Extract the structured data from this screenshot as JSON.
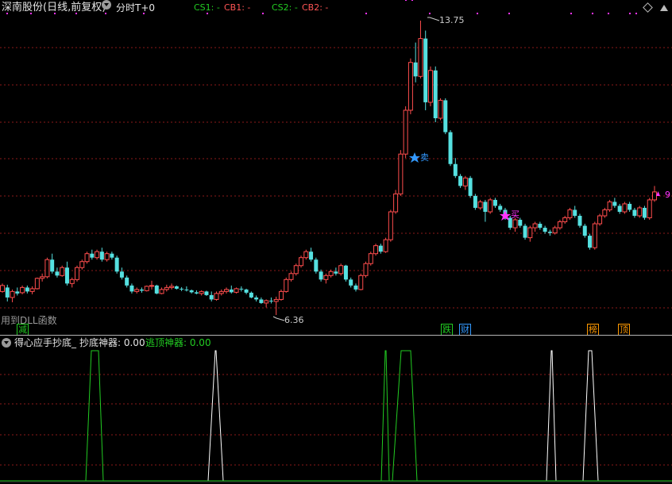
{
  "header": {
    "stock_title": "深南股份(日线,前复权)",
    "period_label": "分时T+0",
    "cs1_label": "CS1: -",
    "cb1_label": "CB1: -",
    "cs2_label": "CS2: -",
    "cb2_label": "CB2: -",
    "diamond_icon": "diamond-icon"
  },
  "main_chart": {
    "high_label": "13.75",
    "low_label": "6.36",
    "sell_marker": "卖",
    "buy_marker": "买",
    "right_edge_label": "9",
    "dll_notice": "用到DLL函数",
    "signal_labels": [
      {
        "text": "减",
        "color": "#22cc22"
      },
      {
        "text": "跌",
        "color": "#22cc22"
      },
      {
        "text": "财",
        "color": "#3399ff"
      },
      {
        "text": "榜",
        "color": "#ff9900"
      },
      {
        "text": "顶",
        "color": "#ff9900"
      }
    ],
    "colors": {
      "up": "#ff4d4d",
      "down": "#55e0e0",
      "grid": "#8b1a1a"
    },
    "candles": [
      [
        6.95,
        7.15,
        6.92,
        7.1
      ],
      [
        7.05,
        7.12,
        6.7,
        6.8
      ],
      [
        6.8,
        7.0,
        6.68,
        6.95
      ],
      [
        6.95,
        7.05,
        6.85,
        6.9
      ],
      [
        6.92,
        7.1,
        6.88,
        7.05
      ],
      [
        7.05,
        7.1,
        6.9,
        6.95
      ],
      [
        6.95,
        7.08,
        6.88,
        7.02
      ],
      [
        7.02,
        7.3,
        7.0,
        7.28
      ],
      [
        7.28,
        7.4,
        7.2,
        7.32
      ],
      [
        7.32,
        7.8,
        7.28,
        7.75
      ],
      [
        7.75,
        7.9,
        7.4,
        7.45
      ],
      [
        7.45,
        7.55,
        7.3,
        7.35
      ],
      [
        7.35,
        7.6,
        7.32,
        7.55
      ],
      [
        7.55,
        7.7,
        7.1,
        7.15
      ],
      [
        7.15,
        7.3,
        7.05,
        7.25
      ],
      [
        7.25,
        7.6,
        7.2,
        7.55
      ],
      [
        7.55,
        7.75,
        7.5,
        7.7
      ],
      [
        7.7,
        7.95,
        7.65,
        7.9
      ],
      [
        7.9,
        8.0,
        7.75,
        7.8
      ],
      [
        7.8,
        8.0,
        7.75,
        7.95
      ],
      [
        7.95,
        8.05,
        7.7,
        7.75
      ],
      [
        7.75,
        7.95,
        7.7,
        7.9
      ],
      [
        7.9,
        7.95,
        7.75,
        7.8
      ],
      [
        7.8,
        7.85,
        7.4,
        7.45
      ],
      [
        7.45,
        7.55,
        7.25,
        7.3
      ],
      [
        7.3,
        7.35,
        7.05,
        7.1
      ],
      [
        7.1,
        7.15,
        6.9,
        6.95
      ],
      [
        6.95,
        7.05,
        6.9,
        7.0
      ],
      [
        7.0,
        7.05,
        6.92,
        6.97
      ],
      [
        6.97,
        7.1,
        6.95,
        7.08
      ],
      [
        7.08,
        7.22,
        7.0,
        7.1
      ],
      [
        7.1,
        7.12,
        6.88,
        6.9
      ],
      [
        6.9,
        7.05,
        6.88,
        7.0
      ],
      [
        7.0,
        7.12,
        6.95,
        7.05
      ],
      [
        7.05,
        7.15,
        7.0,
        7.08
      ],
      [
        7.08,
        7.1,
        7.0,
        7.02
      ],
      [
        7.02,
        7.06,
        6.96,
        7.0
      ],
      [
        7.0,
        7.08,
        6.95,
        6.98
      ],
      [
        6.98,
        7.0,
        6.9,
        6.93
      ],
      [
        6.93,
        6.98,
        6.88,
        6.9
      ],
      [
        6.9,
        6.98,
        6.85,
        6.95
      ],
      [
        6.95,
        6.97,
        6.84,
        6.86
      ],
      [
        6.86,
        6.95,
        6.7,
        6.75
      ],
      [
        6.75,
        6.95,
        6.72,
        6.9
      ],
      [
        6.9,
        7.0,
        6.85,
        6.95
      ],
      [
        6.95,
        7.05,
        6.9,
        7.0
      ],
      [
        7.0,
        7.1,
        6.9,
        6.93
      ],
      [
        6.93,
        7.05,
        6.9,
        7.02
      ],
      [
        7.02,
        7.08,
        6.95,
        7.0
      ],
      [
        7.0,
        7.02,
        6.88,
        6.92
      ],
      [
        6.92,
        6.95,
        6.78,
        6.8
      ],
      [
        6.8,
        6.85,
        6.7,
        6.75
      ],
      [
        6.75,
        6.8,
        6.64,
        6.66
      ],
      [
        6.66,
        6.75,
        6.55,
        6.72
      ],
      [
        6.72,
        6.8,
        6.65,
        6.7
      ],
      [
        6.7,
        6.82,
        6.36,
        6.75
      ],
      [
        6.75,
        7.0,
        6.72,
        6.95
      ],
      [
        6.95,
        7.3,
        6.92,
        7.25
      ],
      [
        7.25,
        7.45,
        7.2,
        7.4
      ],
      [
        7.4,
        7.65,
        7.35,
        7.6
      ],
      [
        7.6,
        7.85,
        7.55,
        7.8
      ],
      [
        7.8,
        8.0,
        7.75,
        7.95
      ],
      [
        7.95,
        8.05,
        7.7,
        7.75
      ],
      [
        7.75,
        7.8,
        7.4,
        7.45
      ],
      [
        7.45,
        7.5,
        7.2,
        7.25
      ],
      [
        7.25,
        7.4,
        7.15,
        7.35
      ],
      [
        7.35,
        7.5,
        7.3,
        7.45
      ],
      [
        7.45,
        7.55,
        7.35,
        7.4
      ],
      [
        7.4,
        7.65,
        7.35,
        7.6
      ],
      [
        7.6,
        7.62,
        7.2,
        7.25
      ],
      [
        7.25,
        7.3,
        7.05,
        7.1
      ],
      [
        7.1,
        7.15,
        6.95,
        7.0
      ],
      [
        7.0,
        7.4,
        6.98,
        7.35
      ],
      [
        7.35,
        7.7,
        7.3,
        7.65
      ],
      [
        7.65,
        7.95,
        7.6,
        7.9
      ],
      [
        7.9,
        8.15,
        7.85,
        8.1
      ],
      [
        8.1,
        8.15,
        7.9,
        7.95
      ],
      [
        7.95,
        8.3,
        7.92,
        8.25
      ],
      [
        8.25,
        9.0,
        8.2,
        8.95
      ],
      [
        8.95,
        9.5,
        8.9,
        9.4
      ],
      [
        9.4,
        10.5,
        9.35,
        10.4
      ],
      [
        10.4,
        11.6,
        10.3,
        11.5
      ],
      [
        11.5,
        12.8,
        11.4,
        12.7
      ],
      [
        12.7,
        13.2,
        12.2,
        12.35
      ],
      [
        12.35,
        13.75,
        12.3,
        13.3
      ],
      [
        13.3,
        13.5,
        11.5,
        11.7
      ],
      [
        11.7,
        12.6,
        11.6,
        12.5
      ],
      [
        12.5,
        12.6,
        11.2,
        11.3
      ],
      [
        11.3,
        11.8,
        11.25,
        11.75
      ],
      [
        11.75,
        11.8,
        10.9,
        10.95
      ],
      [
        10.95,
        11.0,
        10.1,
        10.15
      ],
      [
        10.15,
        10.3,
        9.8,
        9.85
      ],
      [
        9.85,
        9.9,
        9.55,
        9.6
      ],
      [
        9.6,
        9.85,
        9.5,
        9.8
      ],
      [
        9.8,
        9.85,
        9.3,
        9.35
      ],
      [
        9.35,
        9.4,
        9.0,
        9.05
      ],
      [
        9.05,
        9.25,
        9.0,
        9.2
      ],
      [
        9.2,
        9.25,
        8.7,
        8.95
      ],
      [
        8.95,
        9.3,
        8.9,
        9.25
      ],
      [
        9.25,
        9.3,
        9.05,
        9.1
      ],
      [
        9.1,
        9.15,
        8.95,
        9.0
      ],
      [
        9.0,
        9.05,
        8.75,
        8.8
      ],
      [
        8.8,
        8.85,
        8.5,
        8.55
      ],
      [
        8.55,
        8.8,
        8.45,
        8.75
      ],
      [
        8.75,
        8.8,
        8.55,
        8.6
      ],
      [
        8.6,
        8.65,
        8.25,
        8.3
      ],
      [
        8.3,
        8.6,
        8.2,
        8.55
      ],
      [
        8.55,
        8.7,
        8.45,
        8.65
      ],
      [
        8.65,
        8.7,
        8.5,
        8.55
      ],
      [
        8.55,
        8.6,
        8.4,
        8.45
      ],
      [
        8.45,
        8.5,
        8.35,
        8.42
      ],
      [
        8.42,
        8.6,
        8.38,
        8.55
      ],
      [
        8.55,
        8.75,
        8.5,
        8.7
      ],
      [
        8.7,
        8.85,
        8.65,
        8.8
      ],
      [
        8.8,
        9.05,
        8.75,
        9.0
      ],
      [
        9.0,
        9.1,
        8.8,
        8.85
      ],
      [
        8.85,
        8.9,
        8.55,
        8.6
      ],
      [
        8.6,
        8.65,
        8.3,
        8.35
      ],
      [
        8.35,
        8.4,
        8.0,
        8.05
      ],
      [
        8.05,
        8.7,
        8.0,
        8.65
      ],
      [
        8.65,
        8.9,
        8.6,
        8.85
      ],
      [
        8.85,
        9.05,
        8.8,
        9.0
      ],
      [
        9.0,
        9.25,
        8.95,
        9.2
      ],
      [
        9.2,
        9.3,
        9.05,
        9.1
      ],
      [
        9.1,
        9.15,
        8.9,
        8.95
      ],
      [
        8.95,
        9.2,
        8.9,
        9.15
      ],
      [
        9.15,
        9.2,
        8.95,
        9.0
      ],
      [
        9.0,
        9.05,
        8.8,
        8.85
      ],
      [
        8.85,
        9.1,
        8.8,
        9.05
      ],
      [
        9.05,
        9.1,
        8.75,
        8.8
      ],
      [
        8.8,
        9.3,
        8.75,
        9.25
      ],
      [
        9.25,
        9.6,
        9.2,
        9.45
      ]
    ]
  },
  "indicator": {
    "title": "得心应手抄底_",
    "bottom_label": "抄底神器: 0.00",
    "top_label": "逃顶神器: 0.00",
    "colors": {
      "bottom": "#ffffff",
      "top": "#22cc22"
    }
  }
}
